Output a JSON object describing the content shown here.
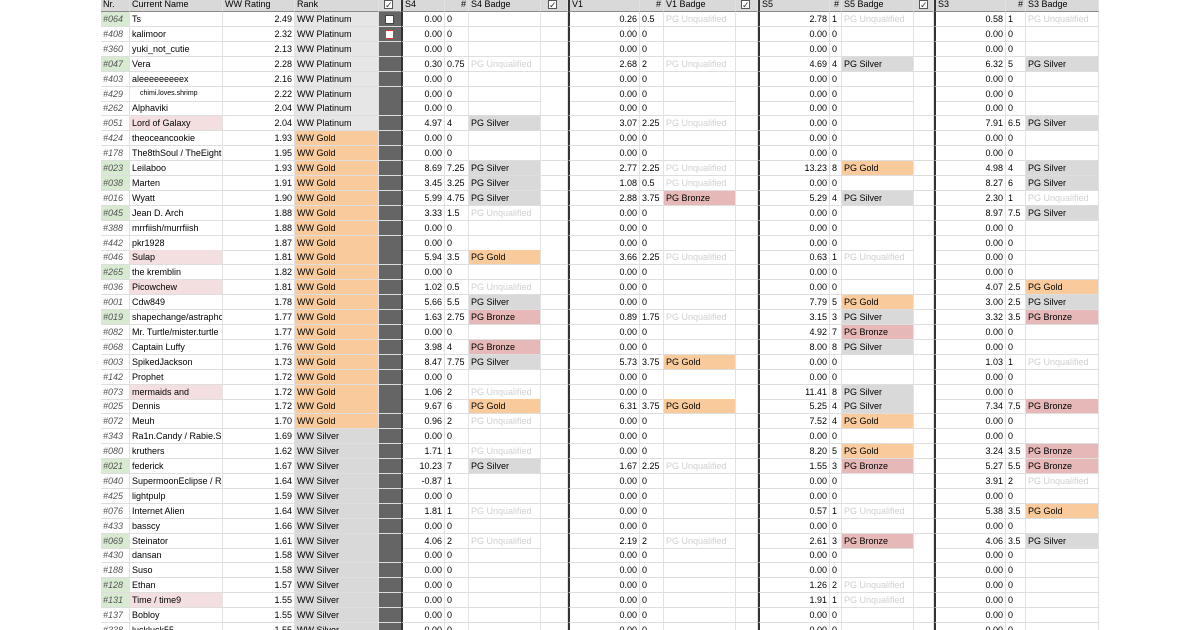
{
  "headers": {
    "nr": "Nr.",
    "name": "Current Name",
    "rating": "WW Rating",
    "rank": "Rank",
    "s4": "S4",
    "s4n": "#",
    "s4b": "S4 Badge",
    "v1": "V1",
    "v1n": "#",
    "v1b": "V1 Badge",
    "s5": "S5",
    "s5n": "#",
    "s5b": "S5 Badge",
    "s3": "S3",
    "s3n": "#",
    "s3b": "S3 Badge"
  },
  "colors": {
    "gold": "#f9cb9c",
    "silver": "#d9d9d9",
    "bronze": "#e6b8b7",
    "pink": "#f4dfe0",
    "green": "#d9ead3",
    "band": "#656565"
  },
  "rows": [
    {
      "nr": "#064",
      "name": "Ts",
      "rating": "2.49",
      "rank": "WW Platinum",
      "s4": "0.00",
      "s4n": "0",
      "s4b": "",
      "v1": "0.26",
      "v1n": "0.5",
      "v1b": "PG Unqualified",
      "s5": "2.78",
      "s5n": "1",
      "s5b": "PG Unqualified",
      "s3": "0.58",
      "s3n": "1",
      "s3b": "PG Unqualified",
      "nrc": "green",
      "namec": ""
    },
    {
      "nr": "#408",
      "name": "kalimoor",
      "rating": "2.32",
      "rank": "WW Platinum",
      "s4": "0.00",
      "s4n": "0",
      "s4b": "",
      "v1": "0.00",
      "v1n": "0",
      "v1b": "",
      "s5": "0.00",
      "s5n": "0",
      "s5b": "",
      "s3": "0.00",
      "s3n": "0",
      "s3b": "",
      "nrc": "",
      "namec": ""
    },
    {
      "nr": "#360",
      "name": "yuki_not_cutie",
      "rating": "2.13",
      "rank": "WW Platinum",
      "s4": "0.00",
      "s4n": "0",
      "s4b": "",
      "v1": "0.00",
      "v1n": "0",
      "v1b": "",
      "s5": "0.00",
      "s5n": "0",
      "s5b": "",
      "s3": "0.00",
      "s3n": "0",
      "s3b": "",
      "nrc": "",
      "namec": ""
    },
    {
      "nr": "#047",
      "name": "Vera",
      "rating": "2.28",
      "rank": "WW Platinum",
      "s4": "0.30",
      "s4n": "0.75",
      "s4b": "PG Unqualified",
      "v1": "2.68",
      "v1n": "2",
      "v1b": "PG Unqualified",
      "s5": "4.69",
      "s5n": "4",
      "s5b": "PG Silver",
      "s3": "6.32",
      "s3n": "5",
      "s3b": "PG Silver",
      "nrc": "green",
      "namec": ""
    },
    {
      "nr": "#403",
      "name": "aleeeeeeeeex",
      "rating": "2.16",
      "rank": "WW Platinum",
      "s4": "0.00",
      "s4n": "0",
      "s4b": "",
      "v1": "0.00",
      "v1n": "0",
      "v1b": "",
      "s5": "0.00",
      "s5n": "0",
      "s5b": "",
      "s3": "0.00",
      "s3n": "0",
      "s3b": "",
      "nrc": "",
      "namec": ""
    },
    {
      "nr": "#429",
      "name": "chimi.loves.shrimp",
      "rating": "2.22",
      "rank": "WW Platinum",
      "s4": "0.00",
      "s4n": "0",
      "s4b": "",
      "v1": "0.00",
      "v1n": "0",
      "v1b": "",
      "s5": "0.00",
      "s5n": "0",
      "s5b": "",
      "s3": "0.00",
      "s3n": "0",
      "s3b": "",
      "nrc": "",
      "namec": "",
      "small": true
    },
    {
      "nr": "#262",
      "name": "Alphaviki",
      "rating": "2.04",
      "rank": "WW Platinum",
      "s4": "0.00",
      "s4n": "0",
      "s4b": "",
      "v1": "0.00",
      "v1n": "0",
      "v1b": "",
      "s5": "0.00",
      "s5n": "0",
      "s5b": "",
      "s3": "0.00",
      "s3n": "0",
      "s3b": "",
      "nrc": "",
      "namec": ""
    },
    {
      "nr": "#051",
      "name": "Lord of Galaxy",
      "rating": "2.04",
      "rank": "WW Platinum",
      "s4": "4.97",
      "s4n": "4",
      "s4b": "PG Silver",
      "v1": "3.07",
      "v1n": "2.25",
      "v1b": "PG Unqualified",
      "s5": "0.00",
      "s5n": "0",
      "s5b": "",
      "s3": "7.91",
      "s3n": "6.5",
      "s3b": "PG Silver",
      "nrc": "",
      "namec": "pink"
    },
    {
      "nr": "#424",
      "name": "theoceancookie",
      "rating": "1.93",
      "rank": "WW Gold",
      "s4": "0.00",
      "s4n": "0",
      "s4b": "",
      "v1": "0.00",
      "v1n": "0",
      "v1b": "",
      "s5": "0.00",
      "s5n": "0",
      "s5b": "",
      "s3": "0.00",
      "s3n": "0",
      "s3b": "",
      "nrc": "",
      "namec": ""
    },
    {
      "nr": "#178",
      "name": "The8thSoul / TheEighthSoul",
      "rating": "1.95",
      "rank": "WW Gold",
      "s4": "0.00",
      "s4n": "0",
      "s4b": "",
      "v1": "0.00",
      "v1n": "0",
      "v1b": "",
      "s5": "0.00",
      "s5n": "0",
      "s5b": "",
      "s3": "0.00",
      "s3n": "0",
      "s3b": "",
      "nrc": "",
      "namec": ""
    },
    {
      "nr": "#023",
      "name": "Leilaboo",
      "rating": "1.93",
      "rank": "WW Gold",
      "s4": "8.69",
      "s4n": "7.25",
      "s4b": "PG Silver",
      "v1": "2.77",
      "v1n": "2.25",
      "v1b": "PG Unqualified",
      "s5": "13.23",
      "s5n": "8",
      "s5b": "PG Gold",
      "s3": "4.98",
      "s3n": "4",
      "s3b": "PG Silver",
      "nrc": "green",
      "namec": ""
    },
    {
      "nr": "#038",
      "name": "Marten",
      "rating": "1.91",
      "rank": "WW Gold",
      "s4": "3.45",
      "s4n": "3.25",
      "s4b": "PG Silver",
      "v1": "1.08",
      "v1n": "0.5",
      "v1b": "PG Unqualified",
      "s5": "0.00",
      "s5n": "0",
      "s5b": "",
      "s3": "8.27",
      "s3n": "6",
      "s3b": "PG Silver",
      "nrc": "green",
      "namec": ""
    },
    {
      "nr": "#016",
      "name": "Wyatt",
      "rating": "1.90",
      "rank": "WW Gold",
      "s4": "5.99",
      "s4n": "4.75",
      "s4b": "PG Silver",
      "v1": "2.88",
      "v1n": "3.75",
      "v1b": "PG Bronze",
      "s5": "5.29",
      "s5n": "4",
      "s5b": "PG Silver",
      "s3": "2.30",
      "s3n": "1",
      "s3b": "PG Unqualified",
      "nrc": "",
      "namec": ""
    },
    {
      "nr": "#045",
      "name": "Jean D. Arch",
      "rating": "1.88",
      "rank": "WW Gold",
      "s4": "3.33",
      "s4n": "1.5",
      "s4b": "PG Unqualified",
      "v1": "0.00",
      "v1n": "0",
      "v1b": "",
      "s5": "0.00",
      "s5n": "0",
      "s5b": "",
      "s3": "8.97",
      "s3n": "7.5",
      "s3b": "PG Silver",
      "nrc": "green",
      "namec": ""
    },
    {
      "nr": "#388",
      "name": "mrrfiish/murrfiish",
      "rating": "1.88",
      "rank": "WW Gold",
      "s4": "0.00",
      "s4n": "0",
      "s4b": "",
      "v1": "0.00",
      "v1n": "0",
      "v1b": "",
      "s5": "0.00",
      "s5n": "0",
      "s5b": "",
      "s3": "0.00",
      "s3n": "0",
      "s3b": "",
      "nrc": "",
      "namec": ""
    },
    {
      "nr": "#442",
      "name": "pkr1928",
      "rating": "1.87",
      "rank": "WW Gold",
      "s4": "0.00",
      "s4n": "0",
      "s4b": "",
      "v1": "0.00",
      "v1n": "0",
      "v1b": "",
      "s5": "0.00",
      "s5n": "0",
      "s5b": "",
      "s3": "0.00",
      "s3n": "0",
      "s3b": "",
      "nrc": "",
      "namec": ""
    },
    {
      "nr": "#046",
      "name": "Sulap",
      "rating": "1.81",
      "rank": "WW Gold",
      "s4": "5.94",
      "s4n": "3.5",
      "s4b": "PG Gold",
      "v1": "3.66",
      "v1n": "2.25",
      "v1b": "PG Unqualified",
      "s5": "0.63",
      "s5n": "1",
      "s5b": "PG Unqualified",
      "s3": "0.00",
      "s3n": "0",
      "s3b": "",
      "nrc": "",
      "namec": "pink"
    },
    {
      "nr": "#265",
      "name": "the kremblin",
      "rating": "1.82",
      "rank": "WW Gold",
      "s4": "0.00",
      "s4n": "0",
      "s4b": "",
      "v1": "0.00",
      "v1n": "0",
      "v1b": "",
      "s5": "0.00",
      "s5n": "0",
      "s5b": "",
      "s3": "0.00",
      "s3n": "0",
      "s3b": "",
      "nrc": "green",
      "namec": ""
    },
    {
      "nr": "#036",
      "name": "Picowchew",
      "rating": "1.81",
      "rank": "WW Gold",
      "s4": "1.02",
      "s4n": "0.5",
      "s4b": "PG Unqualified",
      "v1": "0.00",
      "v1n": "0",
      "v1b": "",
      "s5": "0.00",
      "s5n": "0",
      "s5b": "",
      "s3": "4.07",
      "s3n": "2.5",
      "s3b": "PG Gold",
      "nrc": "",
      "namec": "pink"
    },
    {
      "nr": "#001",
      "name": "Cdw849",
      "rating": "1.78",
      "rank": "WW Gold",
      "s4": "5.66",
      "s4n": "5.5",
      "s4b": "PG Silver",
      "v1": "0.00",
      "v1n": "0",
      "v1b": "",
      "s5": "7.79",
      "s5n": "5",
      "s5b": "PG Gold",
      "s3": "3.00",
      "s3n": "2.5",
      "s3b": "PG Silver",
      "nrc": "",
      "namec": ""
    },
    {
      "nr": "#019",
      "name": "shapechange/astraphobia",
      "rating": "1.77",
      "rank": "WW Gold",
      "s4": "1.63",
      "s4n": "2.75",
      "s4b": "PG Bronze",
      "v1": "0.89",
      "v1n": "1.75",
      "v1b": "PG Unqualified",
      "s5": "3.15",
      "s5n": "3",
      "s5b": "PG Silver",
      "s3": "3.32",
      "s3n": "3.5",
      "s3b": "PG Bronze",
      "nrc": "green",
      "namec": ""
    },
    {
      "nr": "#082",
      "name": "Mr. Turtle/mister.turtle",
      "rating": "1.77",
      "rank": "WW Gold",
      "s4": "0.00",
      "s4n": "0",
      "s4b": "",
      "v1": "0.00",
      "v1n": "0",
      "v1b": "",
      "s5": "4.92",
      "s5n": "7",
      "s5b": "PG Bronze",
      "s3": "0.00",
      "s3n": "0",
      "s3b": "",
      "nrc": "",
      "namec": ""
    },
    {
      "nr": "#068",
      "name": "Captain Luffy",
      "rating": "1.76",
      "rank": "WW Gold",
      "s4": "3.98",
      "s4n": "4",
      "s4b": "PG Bronze",
      "v1": "0.00",
      "v1n": "0",
      "v1b": "",
      "s5": "8.00",
      "s5n": "8",
      "s5b": "PG Silver",
      "s3": "0.00",
      "s3n": "0",
      "s3b": "",
      "nrc": "",
      "namec": ""
    },
    {
      "nr": "#003",
      "name": "SpikedJackson",
      "rating": "1.73",
      "rank": "WW Gold",
      "s4": "8.47",
      "s4n": "7.75",
      "s4b": "PG Silver",
      "v1": "5.73",
      "v1n": "3.75",
      "v1b": "PG Gold",
      "s5": "0.00",
      "s5n": "0",
      "s5b": "",
      "s3": "1.03",
      "s3n": "1",
      "s3b": "PG Unqualified",
      "nrc": "",
      "namec": ""
    },
    {
      "nr": "#142",
      "name": "Prophet",
      "rating": "1.72",
      "rank": "WW Gold",
      "s4": "0.00",
      "s4n": "0",
      "s4b": "",
      "v1": "0.00",
      "v1n": "0",
      "v1b": "",
      "s5": "0.00",
      "s5n": "0",
      "s5b": "",
      "s3": "0.00",
      "s3n": "0",
      "s3b": "",
      "nrc": "",
      "namec": ""
    },
    {
      "nr": "#073",
      "name": "mermaids and",
      "rating": "1.72",
      "rank": "WW Gold",
      "s4": "1.06",
      "s4n": "2",
      "s4b": "PG Unqualified",
      "v1": "0.00",
      "v1n": "0",
      "v1b": "",
      "s5": "11.41",
      "s5n": "8",
      "s5b": "PG Silver",
      "s3": "0.00",
      "s3n": "0",
      "s3b": "",
      "nrc": "",
      "namec": "pink"
    },
    {
      "nr": "#025",
      "name": "Dennis",
      "rating": "1.72",
      "rank": "WW Gold",
      "s4": "9.67",
      "s4n": "6",
      "s4b": "PG Gold",
      "v1": "6.31",
      "v1n": "3.75",
      "v1b": "PG Gold",
      "s5": "5.25",
      "s5n": "4",
      "s5b": "PG Silver",
      "s3": "7.34",
      "s3n": "7.5",
      "s3b": "PG Bronze",
      "nrc": "",
      "namec": ""
    },
    {
      "nr": "#072",
      "name": "Meuh",
      "rating": "1.70",
      "rank": "WW Gold",
      "s4": "0.96",
      "s4n": "2",
      "s4b": "PG Unqualified",
      "v1": "0.00",
      "v1n": "0",
      "v1b": "",
      "s5": "7.52",
      "s5n": "4",
      "s5b": "PG Gold",
      "s3": "0.00",
      "s3n": "0",
      "s3b": "",
      "nrc": "",
      "namec": ""
    },
    {
      "nr": "#343",
      "name": "Ra1n.Candy / Rabie.S",
      "rating": "1.69",
      "rank": "WW Silver",
      "s4": "0.00",
      "s4n": "0",
      "s4b": "",
      "v1": "0.00",
      "v1n": "0",
      "v1b": "",
      "s5": "0.00",
      "s5n": "0",
      "s5b": "",
      "s3": "0.00",
      "s3n": "0",
      "s3b": "",
      "nrc": "",
      "namec": ""
    },
    {
      "nr": "#080",
      "name": "kruthers",
      "rating": "1.62",
      "rank": "WW Silver",
      "s4": "1.71",
      "s4n": "1",
      "s4b": "PG Unqualified",
      "v1": "0.00",
      "v1n": "0",
      "v1b": "",
      "s5": "8.20",
      "s5n": "5",
      "s5b": "PG Gold",
      "s3": "3.24",
      "s3n": "3.5",
      "s3b": "PG Bronze",
      "nrc": "",
      "namec": ""
    },
    {
      "nr": "#021",
      "name": "federick",
      "rating": "1.67",
      "rank": "WW Silver",
      "s4": "10.23",
      "s4n": "7",
      "s4b": "PG Silver",
      "v1": "1.67",
      "v1n": "2.25",
      "v1b": "PG Unqualified",
      "s5": "1.55",
      "s5n": "3",
      "s5b": "PG Bronze",
      "s3": "5.27",
      "s3n": "5.5",
      "s3b": "PG Bronze",
      "nrc": "green",
      "namec": ""
    },
    {
      "nr": "#040",
      "name": "SupermoonEclipse / Rhamnus",
      "rating": "1.64",
      "rank": "WW Silver",
      "s4": "-0.87",
      "s4n": "1",
      "s4b": "",
      "v1": "0.00",
      "v1n": "0",
      "v1b": "",
      "s5": "0.00",
      "s5n": "0",
      "s5b": "",
      "s3": "3.91",
      "s3n": "2",
      "s3b": "PG Unqualified",
      "nrc": "",
      "namec": ""
    },
    {
      "nr": "#425",
      "name": "lightpulp",
      "rating": "1.59",
      "rank": "WW Silver",
      "s4": "0.00",
      "s4n": "0",
      "s4b": "",
      "v1": "0.00",
      "v1n": "0",
      "v1b": "",
      "s5": "0.00",
      "s5n": "0",
      "s5b": "",
      "s3": "0.00",
      "s3n": "0",
      "s3b": "",
      "nrc": "",
      "namec": ""
    },
    {
      "nr": "#076",
      "name": "Internet Alien",
      "rating": "1.64",
      "rank": "WW Silver",
      "s4": "1.81",
      "s4n": "1",
      "s4b": "PG Unqualified",
      "v1": "0.00",
      "v1n": "0",
      "v1b": "",
      "s5": "0.57",
      "s5n": "1",
      "s5b": "PG Unqualified",
      "s3": "5.38",
      "s3n": "3.5",
      "s3b": "PG Gold",
      "nrc": "",
      "namec": ""
    },
    {
      "nr": "#433",
      "name": "basscy",
      "rating": "1.66",
      "rank": "WW Silver",
      "s4": "0.00",
      "s4n": "0",
      "s4b": "",
      "v1": "0.00",
      "v1n": "0",
      "v1b": "",
      "s5": "0.00",
      "s5n": "0",
      "s5b": "",
      "s3": "0.00",
      "s3n": "0",
      "s3b": "",
      "nrc": "",
      "namec": ""
    },
    {
      "nr": "#069",
      "name": "Steinator",
      "rating": "1.61",
      "rank": "WW Silver",
      "s4": "4.06",
      "s4n": "2",
      "s4b": "PG Unqualified",
      "v1": "2.19",
      "v1n": "2",
      "v1b": "PG Unqualified",
      "s5": "2.61",
      "s5n": "3",
      "s5b": "PG Bronze",
      "s3": "4.06",
      "s3n": "3.5",
      "s3b": "PG Silver",
      "nrc": "green",
      "namec": ""
    },
    {
      "nr": "#430",
      "name": "dansan",
      "rating": "1.58",
      "rank": "WW Silver",
      "s4": "0.00",
      "s4n": "0",
      "s4b": "",
      "v1": "0.00",
      "v1n": "0",
      "v1b": "",
      "s5": "0.00",
      "s5n": "0",
      "s5b": "",
      "s3": "0.00",
      "s3n": "0",
      "s3b": "",
      "nrc": "",
      "namec": ""
    },
    {
      "nr": "#188",
      "name": "Suso",
      "rating": "1.58",
      "rank": "WW Silver",
      "s4": "0.00",
      "s4n": "0",
      "s4b": "",
      "v1": "0.00",
      "v1n": "0",
      "v1b": "",
      "s5": "0.00",
      "s5n": "0",
      "s5b": "",
      "s3": "0.00",
      "s3n": "0",
      "s3b": "",
      "nrc": "",
      "namec": ""
    },
    {
      "nr": "#128",
      "name": "Ethan",
      "rating": "1.57",
      "rank": "WW Silver",
      "s4": "0.00",
      "s4n": "0",
      "s4b": "",
      "v1": "0.00",
      "v1n": "0",
      "v1b": "",
      "s5": "1.26",
      "s5n": "2",
      "s5b": "PG Unqualified",
      "s3": "0.00",
      "s3n": "0",
      "s3b": "",
      "nrc": "green",
      "namec": ""
    },
    {
      "nr": "#131",
      "name": "Time / time9",
      "rating": "1.55",
      "rank": "WW Silver",
      "s4": "0.00",
      "s4n": "0",
      "s4b": "",
      "v1": "0.00",
      "v1n": "0",
      "v1b": "",
      "s5": "1.91",
      "s5n": "1",
      "s5b": "PG Unqualified",
      "s3": "0.00",
      "s3n": "0",
      "s3b": "",
      "nrc": "green",
      "namec": "pink"
    },
    {
      "nr": "#137",
      "name": "Bobloy",
      "rating": "1.55",
      "rank": "WW Silver",
      "s4": "0.00",
      "s4n": "0",
      "s4b": "",
      "v1": "0.00",
      "v1n": "0",
      "v1b": "",
      "s5": "0.00",
      "s5n": "0",
      "s5b": "",
      "s3": "0.00",
      "s3n": "0",
      "s3b": "",
      "nrc": "",
      "namec": ""
    },
    {
      "nr": "#338",
      "name": "luckluck55",
      "rating": "1.55",
      "rank": "WW Silver",
      "s4": "0.00",
      "s4n": "0",
      "s4b": "",
      "v1": "0.00",
      "v1n": "0",
      "v1b": "",
      "s5": "0.00",
      "s5n": "0",
      "s5b": "",
      "s3": "0.00",
      "s3n": "0",
      "s3b": "",
      "nrc": "",
      "namec": ""
    }
  ]
}
